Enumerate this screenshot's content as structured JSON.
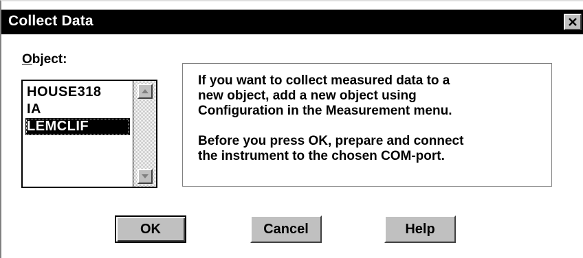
{
  "window": {
    "title": "Collect Data",
    "close_icon": "close-icon"
  },
  "object": {
    "label_mnemonic": "O",
    "label_rest": "bject:",
    "items": [
      "HOUSE318",
      "IA",
      "LEMCLIF"
    ],
    "selected": "LEMCLIF"
  },
  "info": {
    "paragraph1": "If you want to collect measured data to a\nnew object, add a new object using\nConfiguration in the Measurement menu.",
    "paragraph2": "Before you press OK, prepare and connect\nthe instrument to the chosen COM-port."
  },
  "buttons": {
    "ok": "OK",
    "cancel": "Cancel",
    "help": "Help"
  },
  "colors": {
    "titlebar": "#000000",
    "title_text": "#ffffff",
    "button_face": "#c0c0c0",
    "selection": "#000000"
  }
}
